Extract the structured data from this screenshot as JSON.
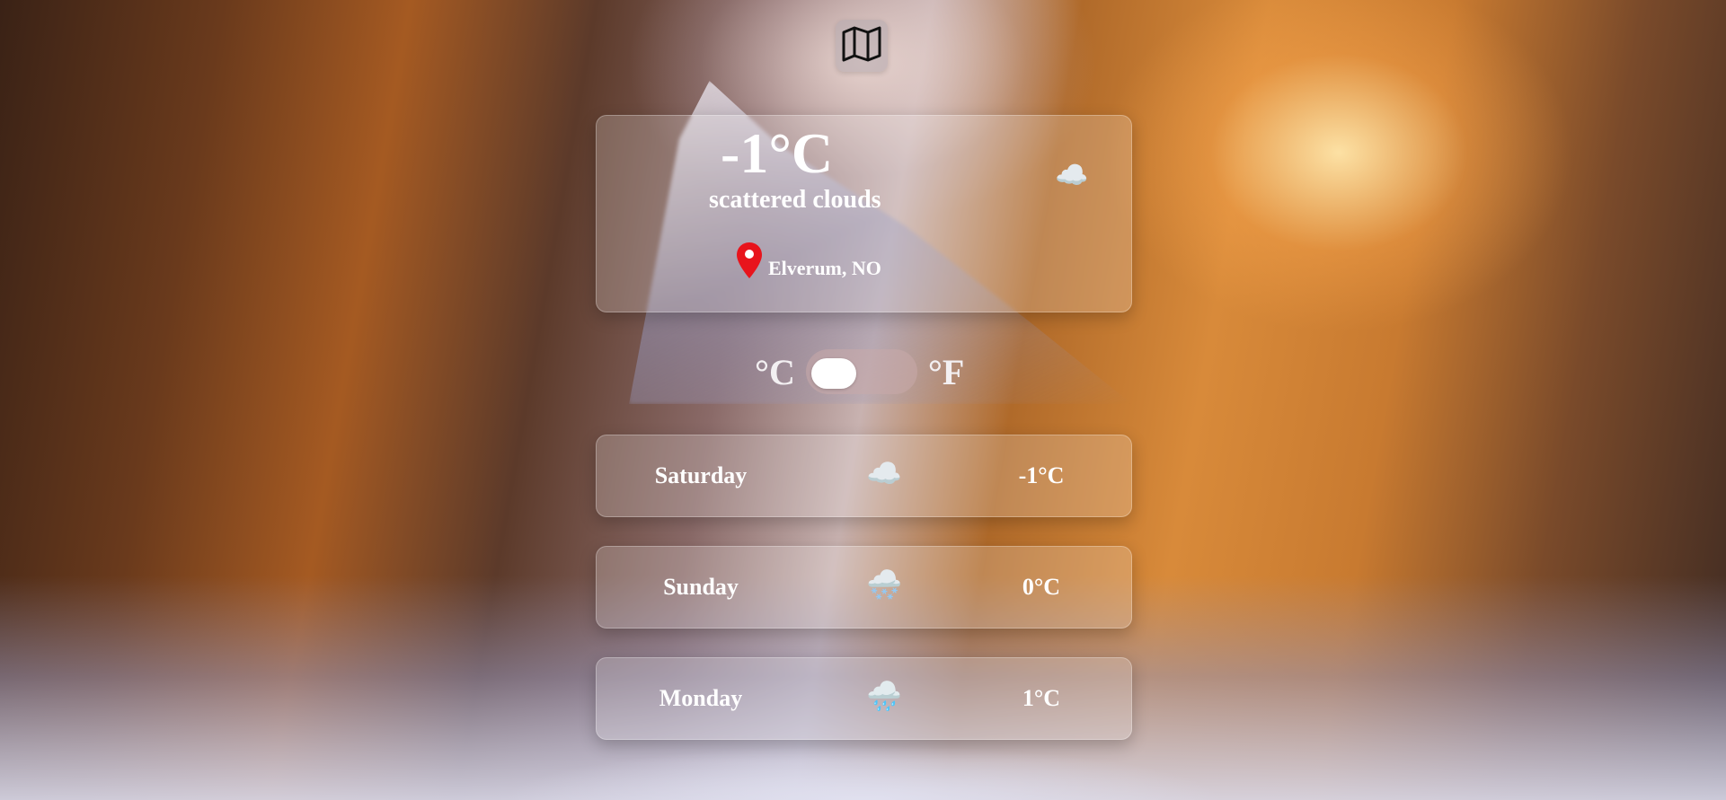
{
  "header": {
    "map_icon": "map-icon"
  },
  "current": {
    "temperature": "-1°C",
    "description": "scattered clouds",
    "icon": "scattered-clouds-icon",
    "icon_glyph": "☁️",
    "location": "Elverum, NO",
    "location_icon": "location-pin-icon",
    "location_pin_color": "#e8141c"
  },
  "units": {
    "celsius_label": "°C",
    "fahrenheit_label": "°F",
    "selected": "celsius"
  },
  "forecast": [
    {
      "day": "Saturday",
      "icon": "cloudy-night-icon",
      "icon_glyph": "☁️",
      "temperature": "-1°C"
    },
    {
      "day": "Sunday",
      "icon": "snow-night-icon",
      "icon_glyph": "🌨️",
      "temperature": "0°C"
    },
    {
      "day": "Monday",
      "icon": "rain-cloud-icon",
      "icon_glyph": "🌧️",
      "temperature": "1°C"
    }
  ]
}
